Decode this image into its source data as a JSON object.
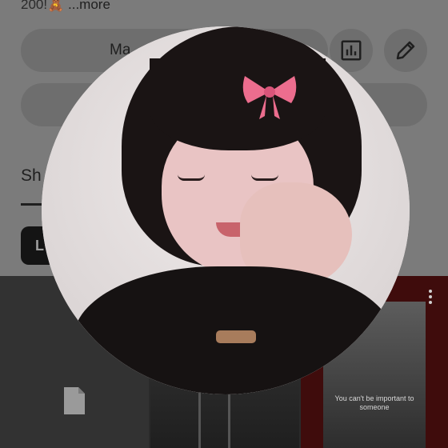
{
  "description": {
    "text": "200!🧸",
    "more_label": "...more"
  },
  "actions": {
    "manage_label": "Ma",
    "stats_icon": "bar-chart-icon",
    "edit_icon": "pencil-icon"
  },
  "tabs": {
    "active_label": "Sh"
  },
  "chips": {
    "first_label": "L"
  },
  "grid": {
    "tiles": [
      {
        "kind": "file-placeholder",
        "icon": "file-icon"
      },
      {
        "kind": "photo"
      },
      {
        "kind": "photo",
        "caption": "You can't be important to someone"
      }
    ],
    "menu_icon": "kebab-icon"
  },
  "overlay": {
    "kind": "enlarged-profile-avatar"
  },
  "colors": {
    "dim_page": "#7b7b7b",
    "pill": "#6e6e6e",
    "dark_chip": "#141414",
    "grid_bg": "#2a2a2a",
    "red_tile": "#3f0c0c",
    "bow_pink": "#ec6d8e"
  }
}
